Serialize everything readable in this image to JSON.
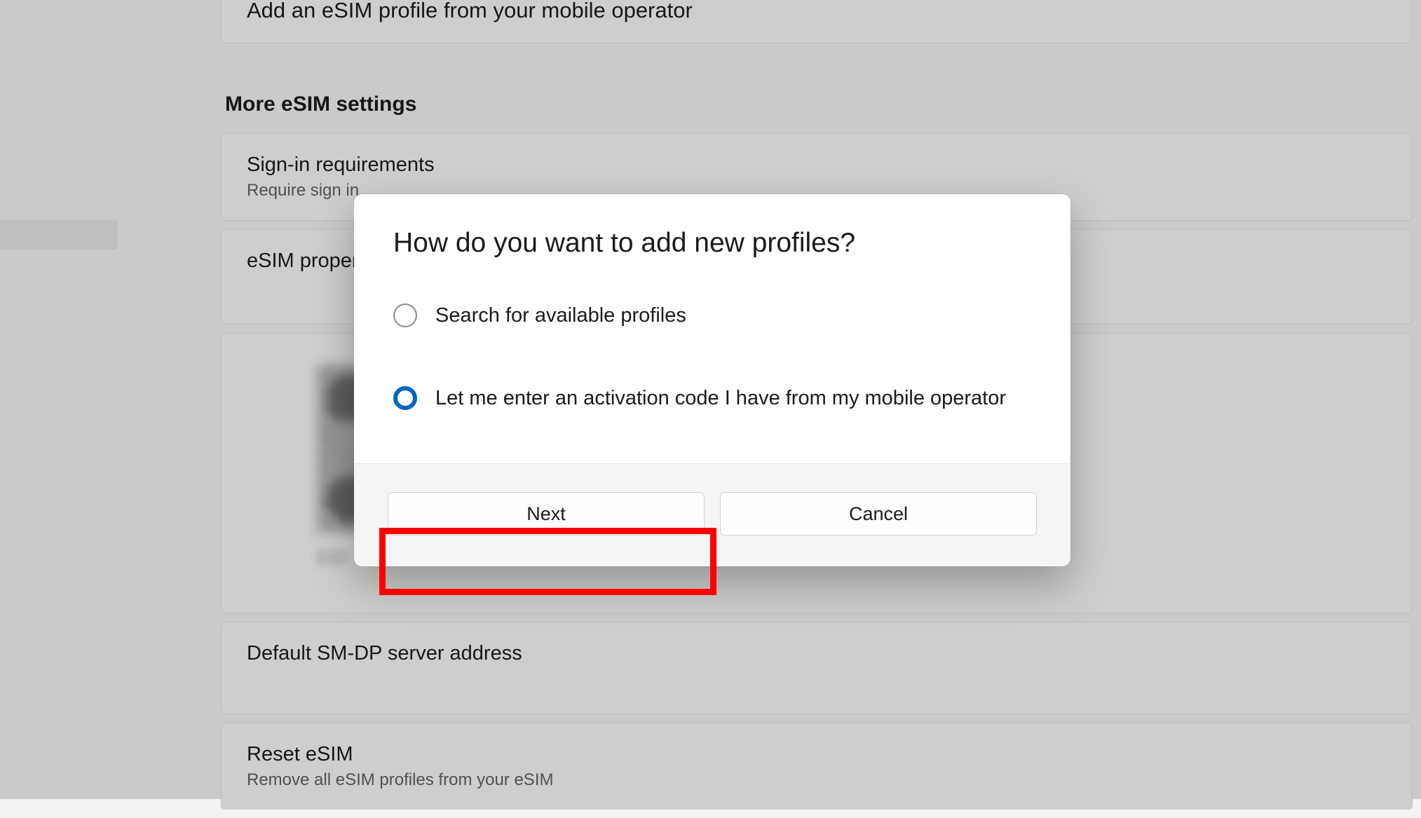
{
  "background": {
    "add_profile_card": "Add an eSIM profile from your mobile operator",
    "section_heading": "More eSIM settings",
    "signin_card": {
      "title": "Sign-in requirements",
      "subtitle": "Require sign in"
    },
    "esim_properties_card": "eSIM properties",
    "qr_label": "EID",
    "smdp_card": "Default SM-DP server address",
    "reset_card": {
      "title": "Reset eSIM",
      "subtitle": "Remove all eSIM profiles from your eSIM"
    }
  },
  "dialog": {
    "title": "How do you want to add new profiles?",
    "options": [
      {
        "label": "Search for available profiles",
        "selected": false
      },
      {
        "label": "Let me enter an activation code I have from my mobile operator",
        "selected": true
      }
    ],
    "next_label": "Next",
    "cancel_label": "Cancel"
  }
}
